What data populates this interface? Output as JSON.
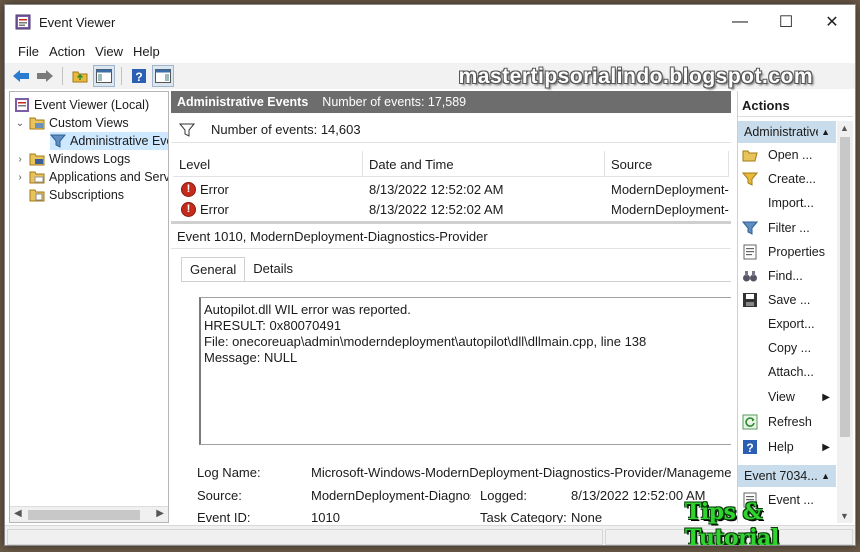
{
  "window": {
    "title": "Event Viewer",
    "controls": {
      "minimize": "—",
      "maximize": "☐",
      "close": "✕"
    }
  },
  "menu": [
    "File",
    "Action",
    "View",
    "Help"
  ],
  "watermark": "mastertipsorialindo.blogspot.com",
  "tree": {
    "items": [
      {
        "label": "Event Viewer (Local)",
        "icon": "event-viewer-icon"
      },
      {
        "label": "Custom Views",
        "icon": "folder-icon",
        "chevron": "⌄"
      },
      {
        "label": "Administrative Events",
        "icon": "filter-icon",
        "selected": true
      },
      {
        "label": "Windows Logs",
        "icon": "folder-icon",
        "chevron": "›"
      },
      {
        "label": "Applications and Services Logs",
        "icon": "folder-icon",
        "chevron": "›"
      },
      {
        "label": "Subscriptions",
        "icon": "subscriptions-icon"
      }
    ]
  },
  "middle": {
    "header_title": "Administrative Events",
    "header_count": "Number of events: 17,589",
    "filter_text": "Number of events: 14,603",
    "columns": [
      "Level",
      "Date and Time",
      "Source"
    ],
    "rows": [
      {
        "level": "Error",
        "datetime": "8/13/2022 12:52:02 AM",
        "source": "ModernDeployment-..."
      },
      {
        "level": "Error",
        "datetime": "8/13/2022 12:52:02 AM",
        "source": "ModernDeployment-..."
      }
    ],
    "detail_title": "Event 1010, ModernDeployment-Diagnostics-Provider",
    "tabs": [
      "General",
      "Details"
    ],
    "message_lines": [
      "Autopilot.dll WIL error was reported.",
      "HRESULT: 0x80070491",
      "File: onecoreuap\\admin\\moderndeployment\\autopilot\\dll\\dllmain.cpp, line 138",
      "Message: NULL"
    ],
    "props": {
      "log_name_label": "Log Name:",
      "log_name_value": "Microsoft-Windows-ModernDeployment-Diagnostics-Provider/Management",
      "source_label": "Source:",
      "source_value": "ModernDeployment-Diagnostics",
      "logged_label": "Logged:",
      "logged_value": "8/13/2022 12:52:00 AM",
      "event_id_label": "Event ID:",
      "event_id_value": "1010",
      "task_label": "Task Category:",
      "task_value": "None"
    }
  },
  "actions": {
    "title": "Actions",
    "section1": "Administrative Events",
    "items1": [
      {
        "label": "Open ...",
        "icon": "open-folder-icon"
      },
      {
        "label": "Create...",
        "icon": "create-filter-icon"
      },
      {
        "label": "Import...",
        "icon": ""
      },
      {
        "label": "Filter ...",
        "icon": "filter-icon"
      },
      {
        "label": "Properties",
        "icon": "properties-icon"
      },
      {
        "label": "Find...",
        "icon": "find-icon"
      },
      {
        "label": "Save ...",
        "icon": "save-icon"
      },
      {
        "label": "Export...",
        "icon": ""
      },
      {
        "label": "Copy ...",
        "icon": ""
      },
      {
        "label": "Attach...",
        "icon": ""
      },
      {
        "label": "View",
        "icon": "",
        "submenu": "▶"
      },
      {
        "label": "Refresh",
        "icon": "refresh-icon"
      },
      {
        "label": "Help",
        "icon": "help-icon",
        "submenu": "▶"
      }
    ],
    "section2": "Event 7034...",
    "items2": [
      {
        "label": "Event ...",
        "icon": "event-properties-icon"
      }
    ]
  },
  "badge": "Tips & Tutorial",
  "colors": {
    "header_bg": "#6d6d6d",
    "section_bg": "#c8dcec",
    "selection_bg": "#cde8ff",
    "error_red": "#c42b1c"
  }
}
